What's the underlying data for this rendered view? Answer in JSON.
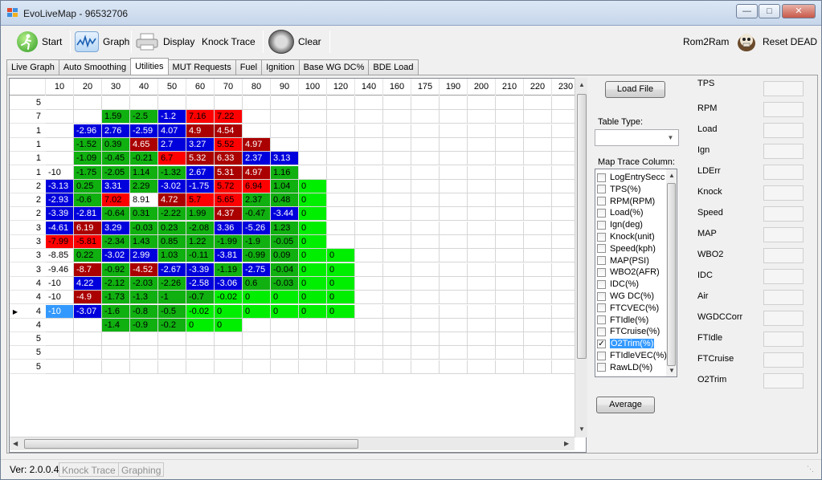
{
  "window": {
    "title": "EvoLiveMap - 96532706",
    "minimize_glyph": "—",
    "maximize_glyph": "□",
    "close_glyph": "✕"
  },
  "toolbar": {
    "start_label": "Start",
    "graph_label": "Graph",
    "display_label": "Display",
    "knock_trace_label": "Knock Trace",
    "clear_label": "Clear",
    "rom2ram_label": "Rom2Ram",
    "reset_dead_label": "Reset DEAD"
  },
  "tabs": [
    {
      "label": "Live Graph"
    },
    {
      "label": "Auto Smoothing"
    },
    {
      "label": "Utilities"
    },
    {
      "label": "MUT Requests"
    },
    {
      "label": "Fuel"
    },
    {
      "label": "Ignition"
    },
    {
      "label": "Base WG DC%"
    },
    {
      "label": "BDE Load"
    }
  ],
  "active_tab": "Utilities",
  "grid": {
    "columns": [
      "10",
      "20",
      "30",
      "40",
      "50",
      "60",
      "70",
      "80",
      "90",
      "100",
      "120",
      "140",
      "160",
      "175",
      "190",
      "200",
      "210",
      "220",
      "230"
    ],
    "rows": [
      {
        "label": "5",
        "cells": [
          [
            "",
            ""
          ],
          [
            "",
            ""
          ],
          [
            "",
            ""
          ],
          [
            "",
            ""
          ],
          [
            "",
            ""
          ],
          [
            "",
            ""
          ],
          [
            "",
            ""
          ],
          [
            "",
            ""
          ]
        ]
      },
      {
        "label": "7",
        "cells": [
          [
            "",
            ""
          ],
          [
            "",
            ""
          ],
          [
            "1.59",
            "G"
          ],
          [
            "-2.5",
            "G"
          ],
          [
            "-1.2",
            "B"
          ],
          [
            "7.16",
            "R"
          ],
          [
            "7.22",
            "R"
          ]
        ]
      },
      {
        "label": "1",
        "cells": [
          [
            "",
            ""
          ],
          [
            "-2.96",
            "B"
          ],
          [
            "2.76",
            "B"
          ],
          [
            "-2.59",
            "B"
          ],
          [
            "4.07",
            "B"
          ],
          [
            "4.9",
            "D"
          ],
          [
            "4.54",
            "D"
          ]
        ]
      },
      {
        "label": "1",
        "cells": [
          [
            "",
            ""
          ],
          [
            "-1.52",
            "G"
          ],
          [
            "0.39",
            "G"
          ],
          [
            "4.65",
            "D"
          ],
          [
            "2.7",
            "B"
          ],
          [
            "3.27",
            "B"
          ],
          [
            "5.52",
            "R"
          ],
          [
            "4.97",
            "D"
          ]
        ]
      },
      {
        "label": "1",
        "cells": [
          [
            "",
            ""
          ],
          [
            "-1.09",
            "G"
          ],
          [
            "-0.45",
            "G"
          ],
          [
            "-0.21",
            "G"
          ],
          [
            "6.7",
            "R"
          ],
          [
            "5.32",
            "D"
          ],
          [
            "6.33",
            "D"
          ],
          [
            "2.37",
            "B"
          ],
          [
            "3.13",
            "B"
          ]
        ]
      },
      {
        "label": "1",
        "cells": [
          [
            "-10",
            "W"
          ],
          [
            "-1.75",
            "G"
          ],
          [
            "-2.05",
            "G"
          ],
          [
            "1.14",
            "G"
          ],
          [
            "-1.32",
            "G"
          ],
          [
            "2.67",
            "B"
          ],
          [
            "5.31",
            "D"
          ],
          [
            "4.97",
            "D"
          ],
          [
            "1.16",
            "G"
          ]
        ]
      },
      {
        "label": "2",
        "cells": [
          [
            "-3.13",
            "B"
          ],
          [
            "0.25",
            "G"
          ],
          [
            "3.31",
            "B"
          ],
          [
            "2.29",
            "G"
          ],
          [
            "-3.02",
            "B"
          ],
          [
            "-1.75",
            "B"
          ],
          [
            "5.72",
            "R"
          ],
          [
            "6.94",
            "R"
          ],
          [
            "1.04",
            "G"
          ],
          [
            "0",
            "L"
          ]
        ]
      },
      {
        "label": "2",
        "cells": [
          [
            "-2.93",
            "B"
          ],
          [
            "-0.6",
            "G"
          ],
          [
            "7.02",
            "R"
          ],
          [
            "8.91",
            "W"
          ],
          [
            "4.72",
            "D"
          ],
          [
            "5.7",
            "R"
          ],
          [
            "5.65",
            "R"
          ],
          [
            "2.37",
            "G"
          ],
          [
            "0.48",
            "G"
          ],
          [
            "0",
            "L"
          ]
        ]
      },
      {
        "label": "2",
        "cells": [
          [
            "-3.39",
            "B"
          ],
          [
            "-2.81",
            "B"
          ],
          [
            "-0.64",
            "G"
          ],
          [
            "0.31",
            "G"
          ],
          [
            "-2.22",
            "G"
          ],
          [
            "1.99",
            "G"
          ],
          [
            "4.37",
            "D"
          ],
          [
            "-0.47",
            "G"
          ],
          [
            "-3.44",
            "B"
          ],
          [
            "0",
            "L"
          ]
        ]
      },
      {
        "label": "3",
        "cells": [
          [
            "-4.61",
            "B"
          ],
          [
            "6.19",
            "D"
          ],
          [
            "3.29",
            "B"
          ],
          [
            "-0.03",
            "G"
          ],
          [
            "0.23",
            "G"
          ],
          [
            "-2.08",
            "G"
          ],
          [
            "3.36",
            "B"
          ],
          [
            "-5.26",
            "B"
          ],
          [
            "1.23",
            "G"
          ],
          [
            "0",
            "L"
          ]
        ]
      },
      {
        "label": "3",
        "cells": [
          [
            "-7.99",
            "R"
          ],
          [
            "-5.81",
            "R"
          ],
          [
            "-2.34",
            "G"
          ],
          [
            "1.43",
            "G"
          ],
          [
            "0.85",
            "G"
          ],
          [
            "1.22",
            "G"
          ],
          [
            "-1.99",
            "G"
          ],
          [
            "-1.9",
            "G"
          ],
          [
            "-0.05",
            "G"
          ],
          [
            "0",
            "L"
          ]
        ]
      },
      {
        "label": "3",
        "cells": [
          [
            "-8.85",
            "W"
          ],
          [
            "0.22",
            "G"
          ],
          [
            "-3.02",
            "B"
          ],
          [
            "2.99",
            "B"
          ],
          [
            "1.03",
            "G"
          ],
          [
            "-0.11",
            "G"
          ],
          [
            "-3.81",
            "B"
          ],
          [
            "-0.99",
            "G"
          ],
          [
            "0.09",
            "G"
          ],
          [
            "0",
            "L"
          ],
          [
            "0",
            "L"
          ]
        ]
      },
      {
        "label": "3",
        "cells": [
          [
            "-9.46",
            "W"
          ],
          [
            "-8.7",
            "D"
          ],
          [
            "-0.92",
            "G"
          ],
          [
            "-4.52",
            "D"
          ],
          [
            "-2.67",
            "B"
          ],
          [
            "-3.39",
            "B"
          ],
          [
            "-1.19",
            "G"
          ],
          [
            "-2.75",
            "B"
          ],
          [
            "-0.04",
            "G"
          ],
          [
            "0",
            "L"
          ],
          [
            "0",
            "L"
          ]
        ]
      },
      {
        "label": "4",
        "cells": [
          [
            "-10",
            "W"
          ],
          [
            "4.22",
            "B"
          ],
          [
            "-2.12",
            "G"
          ],
          [
            "-2.03",
            "G"
          ],
          [
            "-2.26",
            "G"
          ],
          [
            "-2.58",
            "B"
          ],
          [
            "-3.06",
            "B"
          ],
          [
            "0.6",
            "G"
          ],
          [
            "-0.03",
            "G"
          ],
          [
            "0",
            "L"
          ],
          [
            "0",
            "L"
          ]
        ]
      },
      {
        "label": "4",
        "cells": [
          [
            "-10",
            "W"
          ],
          [
            "-4.9",
            "D"
          ],
          [
            "-1.73",
            "G"
          ],
          [
            "-1.3",
            "G"
          ],
          [
            "-1",
            "G"
          ],
          [
            "-0.7",
            "G"
          ],
          [
            "-0.02",
            "L"
          ],
          [
            "0",
            "L"
          ],
          [
            "0",
            "L"
          ],
          [
            "0",
            "L"
          ],
          [
            "0",
            "L"
          ]
        ]
      },
      {
        "label": "4",
        "cells": [
          [
            "-10",
            "S"
          ],
          [
            "-3.07",
            "B"
          ],
          [
            "-1.6",
            "G"
          ],
          [
            "-0.8",
            "G"
          ],
          [
            "-0.5",
            "G"
          ],
          [
            "-0.02",
            "L"
          ],
          [
            "0",
            "L"
          ],
          [
            "0",
            "L"
          ],
          [
            "0",
            "L"
          ],
          [
            "0",
            "L"
          ],
          [
            "0",
            "L"
          ]
        ]
      },
      {
        "label": "4",
        "cells": [
          [
            "",
            ""
          ],
          [
            "",
            ""
          ],
          [
            "-1.4",
            "G"
          ],
          [
            "-0.9",
            "G"
          ],
          [
            "-0.2",
            "G"
          ],
          [
            "0",
            "L"
          ],
          [
            "0",
            "L"
          ]
        ]
      },
      {
        "label": "5",
        "cells": []
      },
      {
        "label": "5",
        "cells": []
      },
      {
        "label": "5",
        "cells": []
      }
    ]
  },
  "colors": {
    "G": "#10b010",
    "L": "#00ee00",
    "B": "#0000dd",
    "D": "#aa0000",
    "R": "#ff0000",
    "W": "#ffffff",
    "S": "#3399ff"
  },
  "panel": {
    "load_file_label": "Load File",
    "table_type_label": "Table Type:",
    "table_type_value": "",
    "map_trace_label": "Map Trace Column:",
    "average_label": "Average",
    "trace_columns": [
      {
        "label": "LogEntrySecc",
        "checked": false
      },
      {
        "label": "TPS(%)",
        "checked": false
      },
      {
        "label": "RPM(RPM)",
        "checked": false
      },
      {
        "label": "Load(%)",
        "checked": false
      },
      {
        "label": "Ign(deg)",
        "checked": false
      },
      {
        "label": "Knock(unit)",
        "checked": false
      },
      {
        "label": "Speed(kph)",
        "checked": false
      },
      {
        "label": "MAP(PSI)",
        "checked": false
      },
      {
        "label": "WBO2(AFR)",
        "checked": false
      },
      {
        "label": "IDC(%)",
        "checked": false
      },
      {
        "label": "WG DC(%)",
        "checked": false
      },
      {
        "label": "FTCVEC(%)",
        "checked": false
      },
      {
        "label": "FTIdle(%)",
        "checked": false
      },
      {
        "label": "FTCruise(%)",
        "checked": false
      },
      {
        "label": "O2Trim(%)",
        "checked": true,
        "selected": true
      },
      {
        "label": "FTIdleVEC(%)",
        "checked": false
      },
      {
        "label": "RawLD(%)",
        "checked": false
      }
    ]
  },
  "status_panel": [
    {
      "label": "TPS"
    },
    {
      "label": "RPM"
    },
    {
      "label": "Load"
    },
    {
      "label": "Ign"
    },
    {
      "label": "LDErr"
    },
    {
      "label": "Knock"
    },
    {
      "label": "Speed"
    },
    {
      "label": "MAP"
    },
    {
      "label": "WBO2"
    },
    {
      "label": "IDC"
    },
    {
      "label": "Air"
    },
    {
      "label": "WGDCCorr"
    },
    {
      "label": "FTIdle"
    },
    {
      "label": "FTCruise"
    },
    {
      "label": "O2Trim"
    }
  ],
  "statusbar": {
    "version": "Ver: 2.0.0.4",
    "knock_trace": "Knock Trace",
    "graphing": "Graphing"
  },
  "icons": {
    "start": "runner-icon",
    "graph": "waveform-icon",
    "display": "printer-icon",
    "clear": "gauge-icon",
    "reset": "skull-icon",
    "current_row": "row-pointer-icon"
  }
}
